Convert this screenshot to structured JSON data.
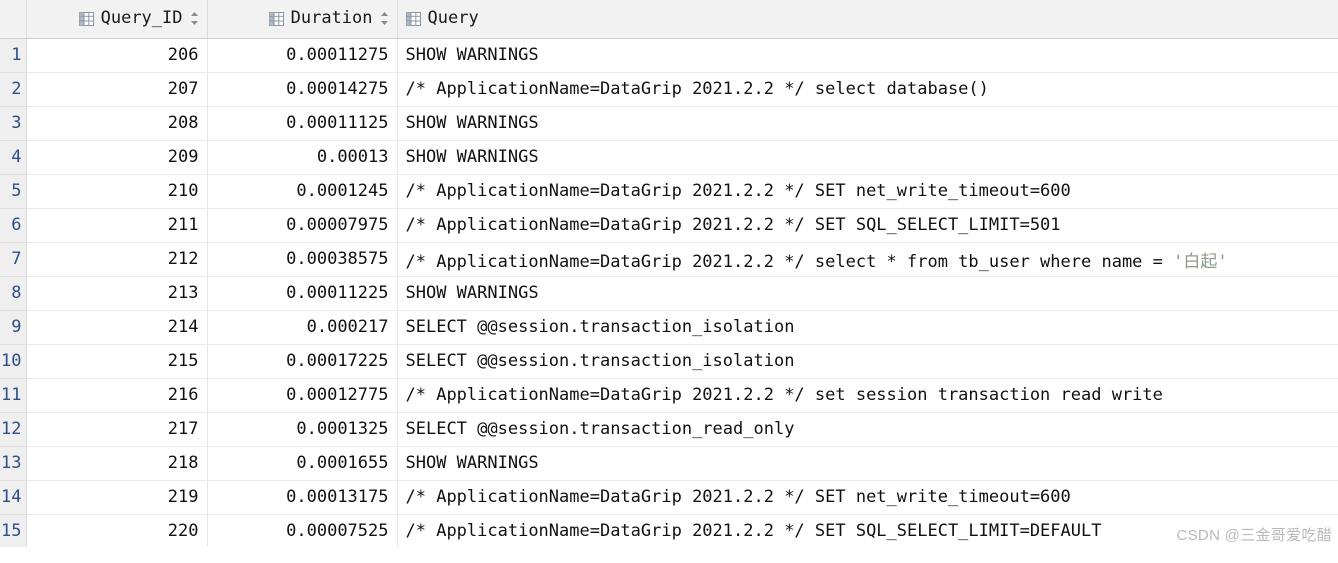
{
  "grid": {
    "columns": [
      {
        "key": "gutter",
        "label": "",
        "icon": "",
        "sortable": false,
        "align": "right"
      },
      {
        "key": "query_id",
        "label": "Query_ID",
        "icon": "table-icon",
        "sortable": true,
        "align": "right"
      },
      {
        "key": "duration",
        "label": "Duration",
        "icon": "table-icon",
        "sortable": true,
        "align": "right"
      },
      {
        "key": "query",
        "label": "Query",
        "icon": "table-icon",
        "sortable": false,
        "align": "left"
      }
    ],
    "rows": [
      {
        "num": "1",
        "query_id": "206",
        "duration": "0.00011275",
        "query": "SHOW WARNINGS"
      },
      {
        "num": "2",
        "query_id": "207",
        "duration": "0.00014275",
        "query": "/* ApplicationName=DataGrip 2021.2.2 */ select database()"
      },
      {
        "num": "3",
        "query_id": "208",
        "duration": "0.00011125",
        "query": "SHOW WARNINGS"
      },
      {
        "num": "4",
        "query_id": "209",
        "duration": "0.00013",
        "query": "SHOW WARNINGS"
      },
      {
        "num": "5",
        "query_id": "210",
        "duration": "0.0001245",
        "query": "/* ApplicationName=DataGrip 2021.2.2 */ SET net_write_timeout=600"
      },
      {
        "num": "6",
        "query_id": "211",
        "duration": "0.00007975",
        "query": "/* ApplicationName=DataGrip 2021.2.2 */ SET SQL_SELECT_LIMIT=501"
      },
      {
        "num": "7",
        "query_id": "212",
        "duration": "0.00038575",
        "query": "/* ApplicationName=DataGrip 2021.2.2 */ select * from tb_user where name = ",
        "query_literal": "'白起'"
      },
      {
        "num": "8",
        "query_id": "213",
        "duration": "0.00011225",
        "query": "SHOW WARNINGS"
      },
      {
        "num": "9",
        "query_id": "214",
        "duration": "0.000217",
        "query": "SELECT @@session.transaction_isolation"
      },
      {
        "num": "10",
        "query_id": "215",
        "duration": "0.00017225",
        "query": "SELECT @@session.transaction_isolation"
      },
      {
        "num": "11",
        "query_id": "216",
        "duration": "0.00012775",
        "query": "/* ApplicationName=DataGrip 2021.2.2 */ set session transaction read write"
      },
      {
        "num": "12",
        "query_id": "217",
        "duration": "0.0001325",
        "query": "SELECT @@session.transaction_read_only"
      },
      {
        "num": "13",
        "query_id": "218",
        "duration": "0.0001655",
        "query": "SHOW WARNINGS"
      },
      {
        "num": "14",
        "query_id": "219",
        "duration": "0.00013175",
        "query": "/* ApplicationName=DataGrip 2021.2.2 */ SET net_write_timeout=600"
      },
      {
        "num": "15",
        "query_id": "220",
        "duration": "0.00007525",
        "query": "/* ApplicationName=DataGrip 2021.2.2 */ SET SQL_SELECT_LIMIT=DEFAULT"
      }
    ]
  },
  "watermark": {
    "text": "CSDN @三金哥爱吃醋"
  },
  "colors": {
    "header_bg": "#f2f2f2",
    "gutter_bg": "#efefef",
    "row_bg": "#ffffff",
    "row_number": "#2c4f8c",
    "text": "#111111",
    "string_literal": "#8a9a8a",
    "grid_line": "#eaeaea",
    "watermark": "#b9b9b9"
  }
}
